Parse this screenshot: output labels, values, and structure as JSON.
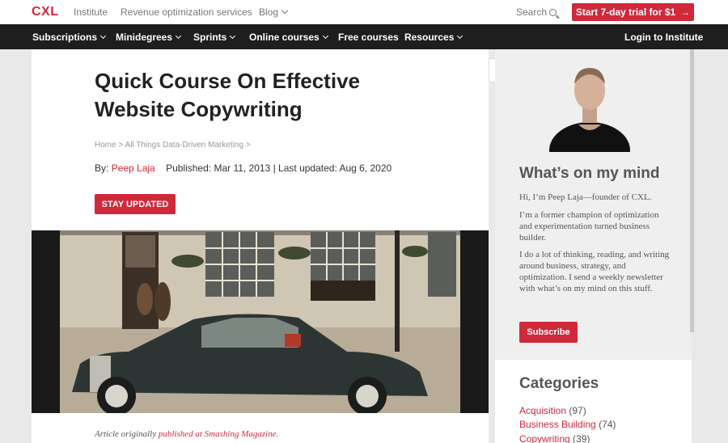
{
  "header": {
    "logo": "CXL",
    "links": [
      "Institute",
      "Revenue optimization services",
      "Blog"
    ],
    "search_label": "Search",
    "trial_button": "Start 7-day trial for $1",
    "trial_arrow": "→"
  },
  "nav": {
    "items": [
      "Subscriptions",
      "Minidegrees",
      "Sprints",
      "Online courses",
      "Free courses",
      "Resources"
    ],
    "login": "Login to Institute"
  },
  "article": {
    "title": "Quick Course On Effective Website Copywriting",
    "breadcrumb": "Home > All Things Data-Driven Marketing >",
    "by_label": "By:",
    "author": "Peep Laja",
    "published": "Published: Mar 11, 2013 | Last updated: Aug 6, 2020",
    "stay_button": "STAY UPDATED",
    "footnote_prefix": "Article originally",
    "footnote_link": "published at Smashing Magazine."
  },
  "sidebar": {
    "heading": "What’s on my mind",
    "paragraphs": [
      "Hi, I’m Peep Laja—founder of CXL.",
      "I’m a former champion of optimization and experimentation turned business builder.",
      "I do a lot of thinking, reading, and writing around business, strategy, and optimization. I send a weekly newsletter with what’s on my mind on this stuff."
    ],
    "subscribe_button": "Subscribe",
    "categories_heading": "Categories",
    "categories": [
      {
        "name": "Acquisition",
        "count": "(97)"
      },
      {
        "name": "Business Building",
        "count": "(74)"
      },
      {
        "name": "Copywriting",
        "count": "(39)"
      }
    ]
  },
  "colors": {
    "accent": "#d0293b",
    "nav_bg": "#1e1e1e",
    "page_bg": "#e9e9e9",
    "sidebar_bg": "#efefef"
  }
}
